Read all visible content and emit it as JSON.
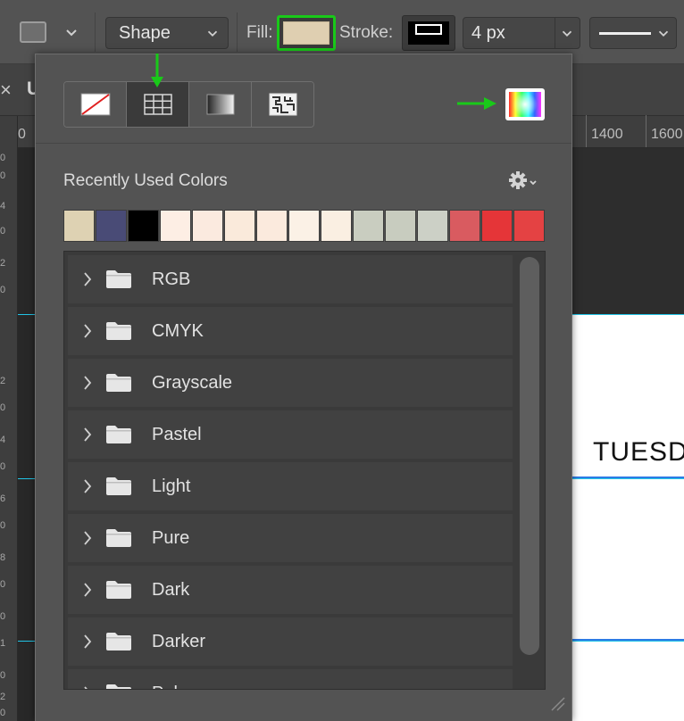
{
  "options_bar": {
    "mode_label": "Shape",
    "fill_label": "Fill:",
    "fill_color": "#dfcfb1",
    "stroke_label": "Stroke:",
    "stroke_width": "4 px"
  },
  "document": {
    "tab_close": "×",
    "tab_title": "U"
  },
  "ruler": {
    "left_label": "0",
    "mark_1400": "1400",
    "mark_1600": "1600",
    "vertical_digits": [
      "0",
      "0",
      "4",
      "0",
      "2",
      "0",
      "2",
      "0",
      "4",
      "0",
      "6",
      "0",
      "8",
      "0",
      "0",
      "1",
      "0",
      "2",
      "0"
    ]
  },
  "canvas": {
    "text": "TUESDA"
  },
  "panel": {
    "modes": [
      "no-color-icon",
      "swatches-grid-icon",
      "gradient-icon",
      "pattern-icon"
    ],
    "active_mode": "swatches-grid-icon",
    "recent_title": "Recently Used Colors",
    "recent_colors": [
      "#ded2b3",
      "#494b76",
      "#000000",
      "#fdeee4",
      "#fbeadf",
      "#faeadb",
      "#fbeadd",
      "#fbf1e6",
      "#faefe2",
      "#c9cdc0",
      "#c8ccbf",
      "#ccd0c6",
      "#d95b60",
      "#e53538",
      "#e44243"
    ],
    "folders": [
      "RGB",
      "CMYK",
      "Grayscale",
      "Pastel",
      "Light",
      "Pure",
      "Dark",
      "Darker",
      "Pale"
    ]
  },
  "annotation_color": "#19c919"
}
